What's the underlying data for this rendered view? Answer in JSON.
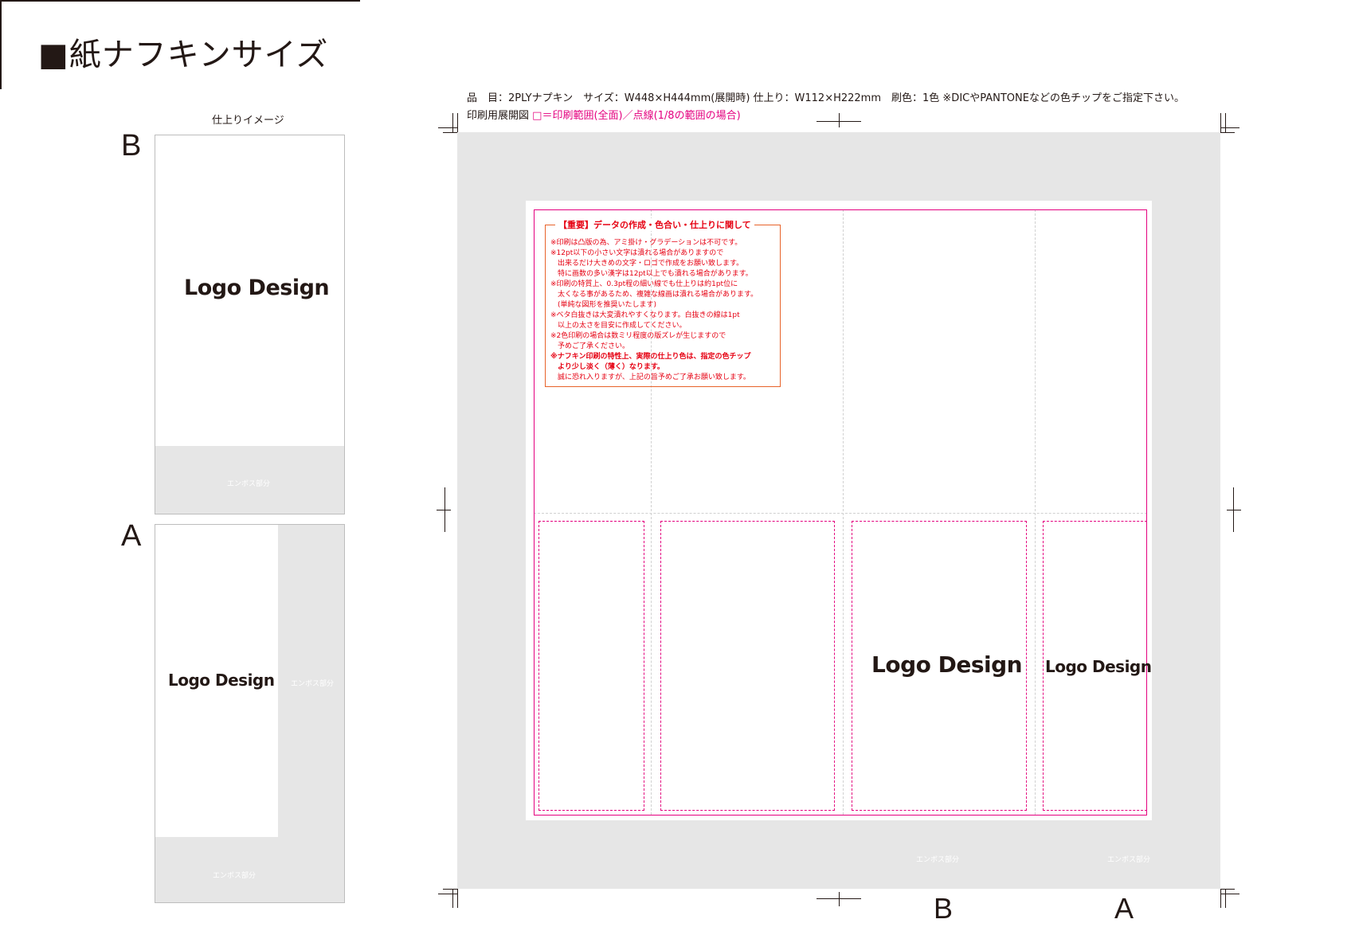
{
  "header": {
    "title": "■紙ナフキンサイズ"
  },
  "preview": {
    "caption": "仕上りイメージ",
    "label_b": "B",
    "label_a": "A",
    "logo_text": "Logo Design",
    "emboss_label": "エンボス部分"
  },
  "spec": {
    "line1": "品　目：2PLYナプキン　サイズ：W448×H444mm(展開時) 仕上り：W112×H222mm　刷色：1色 ※DICやPANTONEなどの色チップをご指定下さい。",
    "legend_prefix": "印刷用展開図",
    "legend_magenta": "□＝印刷範囲(全面)／点線(1/8の範囲の場合)"
  },
  "notice": {
    "title": "【重要】データの作成・色合い・仕上りに関して",
    "lines": [
      "※印刷は凸版の為、アミ掛け・グラデーションは不可です。",
      "※12pt以下の小さい文字は潰れる場合がありますので",
      "　出来るだけ大きめの文字・ロゴで作成をお願い致します。",
      "　特に画数の多い漢字は12pt以上でも潰れる場合があります。",
      "※印刷の特質上、0.3pt程の細い線でも仕上りは約1pt位に",
      "　太くなる事があるため、複雑な線画は潰れる場合があります。",
      "　(単純な図形を推奨いたします)",
      "※ベタ白抜きは大変潰れやすくなります。白抜きの線は1pt",
      "　以上の太さを目安に作成してください。",
      "※2色印刷の場合は数ミリ程度の版ズレが生じますので",
      "　予めご了承ください。",
      "※ナフキン印刷の特性上、実際の仕上り色は、指定の色チップ",
      "　より少し淡く（薄く）なります。",
      "　誠に恐れ入りますが、上記の旨予めご了承お願い致します。"
    ]
  },
  "layout_labels": {
    "logo_text": "Logo Design",
    "emboss_label": "エンボス部分",
    "bottom_b": "B",
    "bottom_a": "A"
  },
  "colors": {
    "ink": "#231815",
    "magenta": "#e4007f",
    "notice_red": "#e60012",
    "notice_border": "#e8632a",
    "emboss_gray": "#e6e6e6"
  }
}
